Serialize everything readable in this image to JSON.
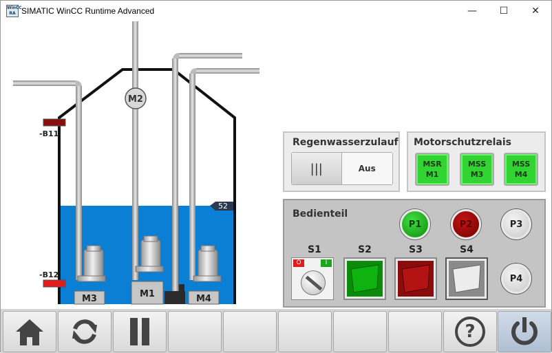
{
  "window": {
    "title": "SIMATIC WinCC Runtime Advanced",
    "icon_text_top": "WinCC",
    "icon_text_bottom": "RA",
    "minimize_symbol": "—",
    "maximize_symbol": "☐",
    "close_symbol": "✕"
  },
  "tank": {
    "level_value": "52",
    "sensor_top_label": "-B11",
    "sensor_bottom_label": "-B12",
    "motor_top_label": "M2",
    "pump_labels": [
      "M3",
      "M1",
      "M4"
    ],
    "water_color": "#0a7fd4"
  },
  "regenwasser": {
    "title": "Regenwasserzulauf",
    "switch_on_symbol": "|||",
    "switch_off_label": "Aus"
  },
  "motorschutz": {
    "title": "Motorschutzrelais",
    "buttons": [
      {
        "line1": "MSR",
        "line2": "M1"
      },
      {
        "line1": "MSS",
        "line2": "M3"
      },
      {
        "line1": "MSS",
        "line2": "M4"
      }
    ]
  },
  "bedienteil": {
    "title": "Bedienteil",
    "lamps": [
      "P1",
      "P2",
      "P3",
      "P4"
    ],
    "switches": [
      "S1",
      "S2",
      "S3",
      "S4"
    ],
    "selector_off": "O",
    "selector_on": "I"
  },
  "toolbar": {
    "icons": [
      "home-icon",
      "refresh-icon",
      "pause-icon",
      "",
      "",
      "",
      "",
      "",
      "help-icon",
      "power-icon"
    ],
    "help_symbol": "?"
  }
}
